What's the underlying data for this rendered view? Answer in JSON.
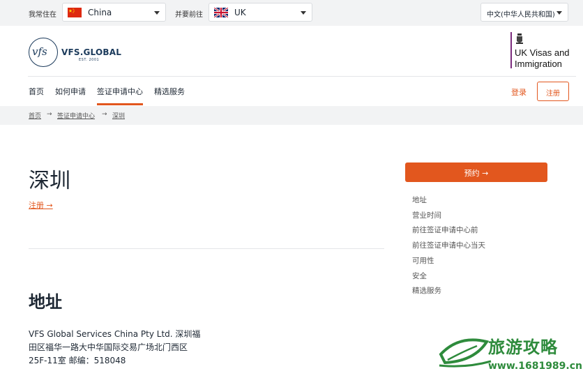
{
  "topbar": {
    "residence_label": "我常住在",
    "residence_value": "China",
    "destination_label": "并要前往",
    "destination_value": "UK",
    "language_value": "中文(中华人民共和国)"
  },
  "header": {
    "logo_mark": "vfs",
    "logo_text": "VFS.GLOBAL",
    "logo_est": "EST. 2001",
    "partner_line1": "UK Visas and",
    "partner_line2": "Immigration"
  },
  "nav": {
    "items": [
      "首页",
      "如何申请",
      "签证申请中心",
      "精选服务"
    ],
    "active": "签证申请中心",
    "login": "登录",
    "register": "注册"
  },
  "breadcrumb": {
    "items": [
      "首页",
      "签证申请中心",
      "深圳"
    ],
    "separator": "→"
  },
  "main": {
    "title": "深圳",
    "register_link": "注册 →",
    "section_title": "地址",
    "address_lines": [
      "VFS Global Services China Pty Ltd. 深圳福",
      "田区福华一路大中华国际交易广场北门西区",
      "25F-11室 邮编：518048"
    ]
  },
  "side": {
    "book_button": "预约 →",
    "links": [
      "地址",
      "营业时间",
      "前往签证申请中心前",
      "前往签证申请中心当天",
      "可用性",
      "安全",
      "精选服务"
    ]
  },
  "watermark": {
    "title": "旅游攻略",
    "url": "www.1681989.cn"
  },
  "colors": {
    "accent": "#e2571e",
    "navy": "#1b3a5b",
    "topbar_bg": "#f2f3f4",
    "ukvi_purple": "#7b2c7d",
    "watermark_green": "#2e8b3c"
  }
}
